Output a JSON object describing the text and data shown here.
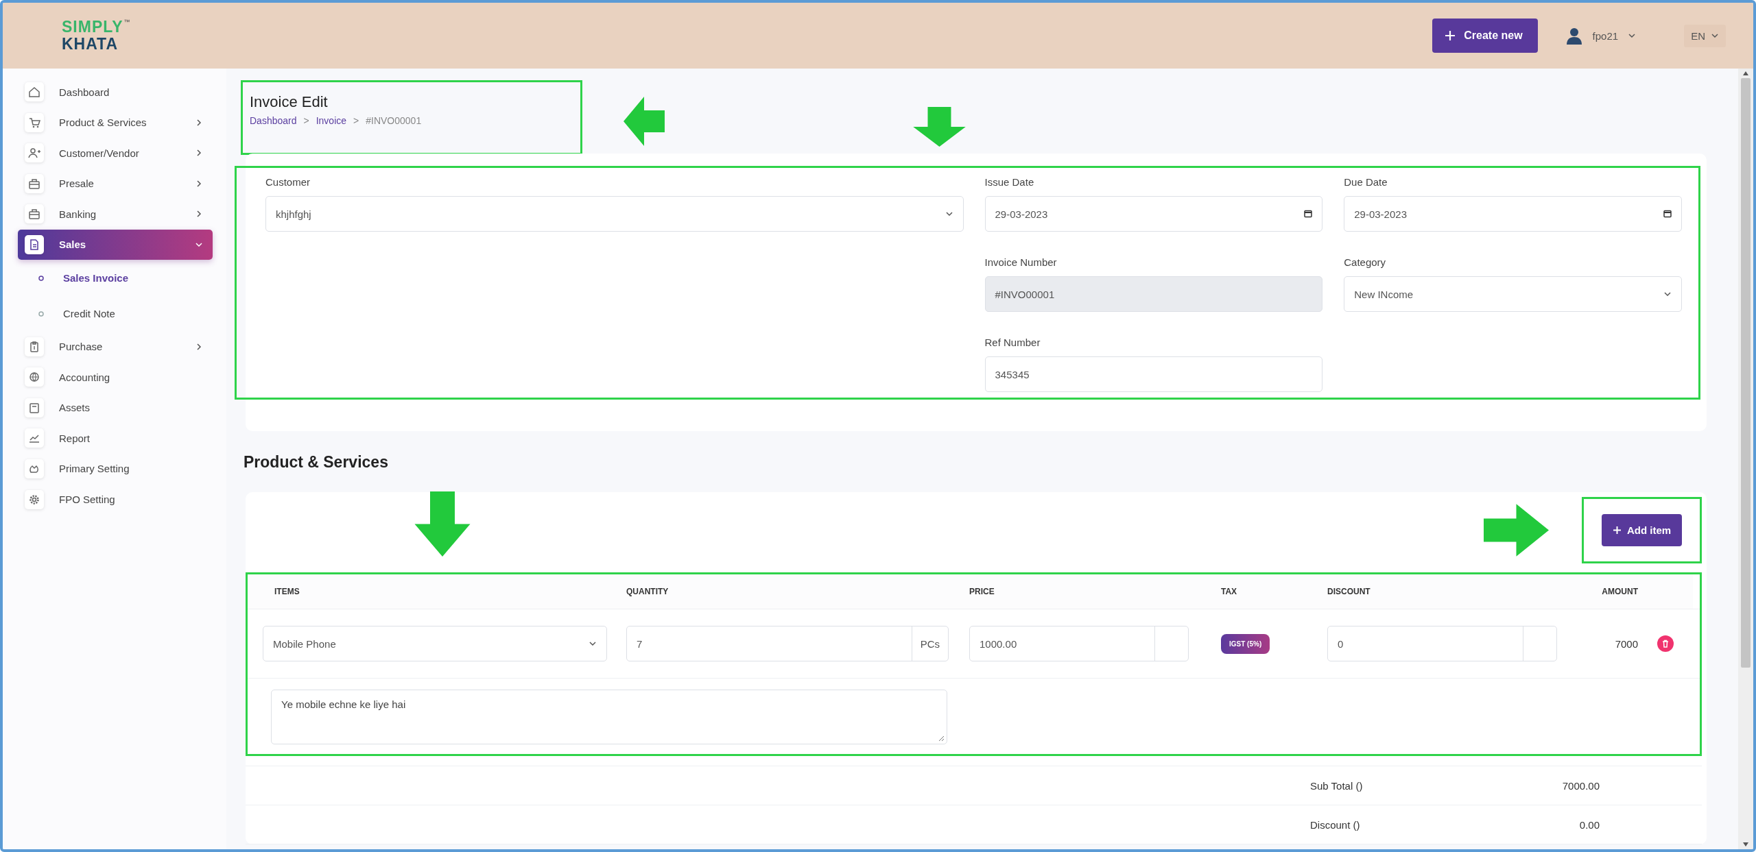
{
  "header": {
    "logo": {
      "line_1": "SIMPLY",
      "mark": "™",
      "line_2": "KHATA"
    },
    "create_button": "Create new",
    "user": "fpo21",
    "language": "EN"
  },
  "sidebar": {
    "items": [
      {
        "label": "Dashboard",
        "selected": false
      },
      {
        "label": "Product & Services",
        "selected": false,
        "expanded": false
      },
      {
        "label": "Customer/Vendor",
        "selected": false,
        "expanded": false
      },
      {
        "label": "Presale",
        "selected": false,
        "expanded": false
      },
      {
        "label": "Banking",
        "selected": false,
        "expanded": false
      },
      {
        "label": "Sales",
        "selected": true,
        "expanded": true,
        "children": [
          {
            "label": "Sales Invoice",
            "selected": true
          },
          {
            "label": "Credit Note",
            "selected": false
          }
        ]
      },
      {
        "label": "Purchase",
        "selected": false,
        "expanded": false
      },
      {
        "label": "Accounting",
        "selected": false
      },
      {
        "label": "Assets",
        "selected": false
      },
      {
        "label": "Report",
        "selected": false
      },
      {
        "label": "Primary Setting",
        "selected": false
      },
      {
        "label": "FPO Setting",
        "selected": false
      }
    ]
  },
  "page": {
    "title": "Invoice Edit",
    "breadcrumb": [
      "Dashboard",
      "Invoice",
      "#INVO00001"
    ],
    "breadcrumb_separator": ">"
  },
  "form": {
    "fields": [
      {
        "kind": "select",
        "label": "Customer",
        "value": "khjhfghj",
        "disabled": false
      },
      {
        "kind": "date",
        "label": "Issue Date",
        "value": "29-03-2023",
        "disabled": false
      },
      {
        "kind": "date",
        "label": "Due Date",
        "value": "29-03-2023",
        "disabled": false
      },
      {
        "kind": "text",
        "label": "Invoice Number",
        "value": "#INVO00001",
        "disabled": true
      },
      {
        "kind": "select",
        "label": "Category",
        "value": "New INcome",
        "disabled": false
      },
      {
        "kind": "text",
        "label": "Ref Number",
        "value": "345345",
        "disabled": false
      }
    ]
  },
  "products": {
    "heading": "Product & Services",
    "add_button": "Add item",
    "columns": [
      "ITEMS",
      "QUANTITY",
      "PRICE",
      "TAX",
      "DISCOUNT",
      "AMOUNT"
    ],
    "rows": [
      {
        "item": "Mobile Phone",
        "quantity": "7",
        "unit": "PCs",
        "price": "1000.00",
        "tax": "IGST (5%)",
        "discount": "0",
        "amount": "7000",
        "description": "Ye mobile echne ke liye hai"
      }
    ],
    "totals": [
      {
        "label": "Sub Total ()",
        "value": "7000.00"
      },
      {
        "label": "Discount ()",
        "value": "0.00"
      }
    ]
  }
}
